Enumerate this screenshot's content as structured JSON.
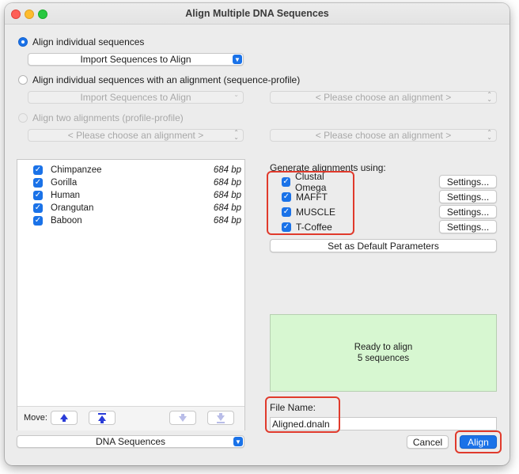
{
  "window": {
    "title": "Align Multiple DNA Sequences"
  },
  "mode_options": {
    "individual_label": "Align individual sequences",
    "profile_label": "Align individual sequences with an alignment (sequence-profile)",
    "two_alignments_label": "Align two alignments (profile-profile)"
  },
  "import_popup": {
    "label": "Import Sequences to Align"
  },
  "import_popup_disabled": {
    "label": "Import Sequences to Align"
  },
  "choose_alignment_1": {
    "label": "< Please choose an alignment >"
  },
  "choose_alignment_2": {
    "label": "< Please choose an alignment >"
  },
  "choose_alignment_3": {
    "label": "< Please choose an alignment >"
  },
  "sequences": [
    {
      "name": "Chimpanzee",
      "length": "684 bp",
      "checked": true
    },
    {
      "name": "Gorilla",
      "length": "684 bp",
      "checked": true
    },
    {
      "name": "Human",
      "length": "684 bp",
      "checked": true
    },
    {
      "name": "Orangutan",
      "length": "684 bp",
      "checked": true
    },
    {
      "name": "Baboon",
      "length": "684 bp",
      "checked": true
    }
  ],
  "move_bar": {
    "label": "Move:"
  },
  "sequence_type": {
    "label": "DNA Sequences"
  },
  "generate": {
    "heading": "Generate alignments using:",
    "aligners": [
      {
        "name": "Clustal Omega",
        "checked": true,
        "settings_label": "Settings..."
      },
      {
        "name": "MAFFT",
        "checked": true,
        "settings_label": "Settings..."
      },
      {
        "name": "MUSCLE",
        "checked": true,
        "settings_label": "Settings..."
      },
      {
        "name": "T-Coffee",
        "checked": true,
        "settings_label": "Settings..."
      }
    ],
    "default_params_label": "Set as Default Parameters"
  },
  "status": {
    "line1": "Ready to align",
    "line2": "5 sequences"
  },
  "file": {
    "label": "File Name:",
    "value": "Aligned.dnaln"
  },
  "buttons": {
    "cancel": "Cancel",
    "align": "Align"
  },
  "colors": {
    "accent": "#1a72e8",
    "highlight": "#e03a2c",
    "status_bg": "#d7f7d1"
  }
}
